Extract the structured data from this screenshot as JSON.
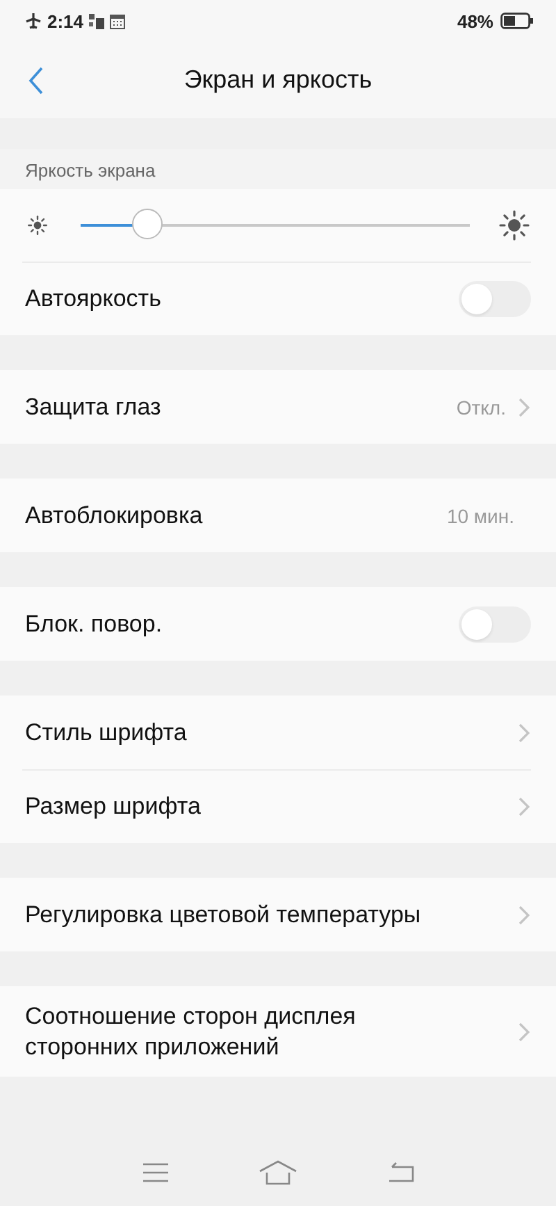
{
  "status_bar": {
    "time": "2:14",
    "battery": "48%"
  },
  "header": {
    "title": "Экран и яркость"
  },
  "groups": [
    {
      "label": "Яркость экрана",
      "items": [
        {
          "kind": "slider",
          "level": 0.17
        },
        {
          "kind": "toggle",
          "label": "Автояркость",
          "on": false
        }
      ]
    },
    {
      "items": [
        {
          "kind": "value",
          "label": "Защита глаз",
          "value": "Откл.",
          "chevron": true
        }
      ]
    },
    {
      "items": [
        {
          "kind": "value",
          "label": "Автоблокировка",
          "value": "10 мин.",
          "chevron": false
        }
      ]
    },
    {
      "items": [
        {
          "kind": "toggle",
          "label": "Блок. повор.",
          "on": false
        }
      ]
    },
    {
      "items": [
        {
          "kind": "value",
          "label": "Стиль шрифта",
          "chevron": true
        },
        {
          "kind": "value",
          "label": "Размер шрифта",
          "chevron": true
        }
      ]
    },
    {
      "items": [
        {
          "kind": "value",
          "label": "Регулировка цветовой температуры",
          "chevron": true
        }
      ]
    },
    {
      "items": [
        {
          "kind": "value",
          "label": "Соотношение сторон дисплея сторонних приложений",
          "chevron": true
        }
      ]
    }
  ]
}
